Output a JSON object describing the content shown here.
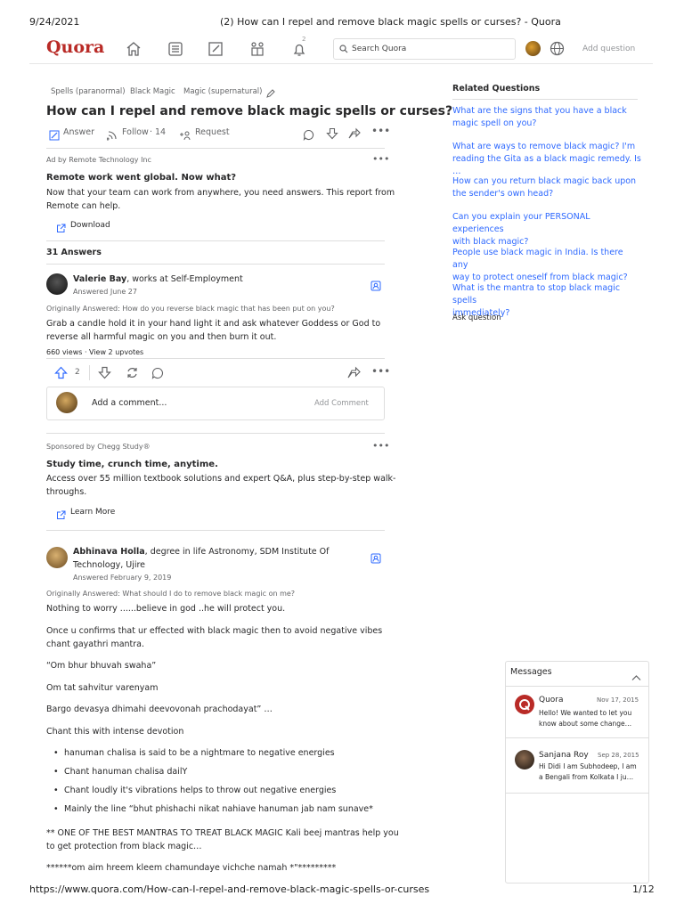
{
  "print_header": {
    "date": "9/24/2021",
    "title": "(2) How can I repel and remove black magic spells or curses? - Quora"
  },
  "print_footer": {
    "url": "https://www.quora.com/How-can-I-repel-and-remove-black-magic-spells-or-curses",
    "page": "1/12"
  },
  "nav": {
    "logo": "Quora",
    "notif_count": "2",
    "search_placeholder": "Search Quora",
    "add_question": "Add question",
    "icons": [
      "home-icon",
      "following-icon",
      "answer-icon",
      "spaces-icon",
      "notifications-icon",
      "globe-icon"
    ]
  },
  "question": {
    "topics": [
      "Spells (paranormal)",
      "Black Magic",
      "Magic (supernatural)"
    ],
    "title": "How can I repel and remove black magic spells or curses?",
    "actions": {
      "answer": "Answer",
      "follow": "Follow",
      "follow_count": "14",
      "request": "Request"
    }
  },
  "ad1": {
    "label": "Ad by Remote Technology Inc",
    "headline": "Remote work went global. Now what?",
    "line1": "Now that your team can work from anywhere, you need answers. This report from",
    "line2": "Remote can help.",
    "cta": "Download"
  },
  "answers_count": "31 Answers",
  "answer1": {
    "name": "Valerie Bay",
    "cred": ", works at Self-Employment",
    "date": "Answered June 27",
    "orig": "Originally Answered: How do you reverse black magic that has been put on you?",
    "line1": "Grab a candle hold it in your hand light it and ask whatever Goddess or God to",
    "line2": "reverse all harmful magic on you and then burn it out.",
    "stats": "660 views · View 2 upvotes",
    "upvotes": "2",
    "comment_placeholder": "Add a comment...",
    "comment_btn": "Add Comment"
  },
  "ad2": {
    "label": "Sponsored by Chegg Study®",
    "headline": "Study time, crunch time, anytime.",
    "line1": "Access over 55 million textbook solutions and expert Q&A, plus step-by-step walk-",
    "line2": "throughs.",
    "cta": "Learn More"
  },
  "answer2": {
    "name": "Abhinava Holla",
    "cred1": ", degree in life Astronomy, SDM Institute Of",
    "cred2": "Technology, Ujire",
    "date": "Answered February 9, 2019",
    "orig": "Originally Answered: What should I do to remove black magic on me?",
    "p1": "Nothing to worry ......believe in god ..he will protect you.",
    "p2a": "Once u confirms that ur effected with black magic then to avoid negative vibes",
    "p2b": "chant gayathri mantra.",
    "p3": "“Om bhur bhuvah swaha”",
    "p4": "Om tat sahvitur varenyam",
    "p5": "Bargo devasya dhimahi deevovonah prachodayat” …",
    "p6": "Chant this with intense devotion",
    "bullets": [
      "hanuman chalisa is said to be a nightmare to negative energies",
      "Chant hanuman chalisa dailY",
      "Chant loudly it's vibrations helps to throw out negative energies",
      "Mainly the line “bhut phishachi nikat nahiave hanuman jab nam sunave*"
    ],
    "p7a": "** ONE OF THE BEST MANTRAS TO TREAT BLACK MAGIC Kali beej mantras help you",
    "p7b": "to get protection from black magic…",
    "p8": "******om aim hreem kleem chamundaye vichche namah *\"*********"
  },
  "related": {
    "title": "Related Questions",
    "items": [
      [
        "What are the signs that you have a black",
        "magic spell on you?"
      ],
      [
        "What are ways to remove black magic? I'm",
        "reading the Gita as a black magic remedy. Is …"
      ],
      [
        "How can you return black magic back upon",
        "the sender's own head?"
      ],
      [
        "Can you explain your PERSONAL experiences",
        "with black magic?"
      ],
      [
        "People use black magic in India. Is there any",
        "way to protect oneself from black magic?"
      ],
      [
        "What is the mantra to stop black magic spells",
        "immediately?"
      ]
    ],
    "ask": "Ask question"
  },
  "messages": {
    "title": "Messages",
    "items": [
      {
        "name": "Quora",
        "date": "Nov 17, 2015",
        "line1": "Hello! We wanted to let you",
        "line2": "know about some change…"
      },
      {
        "name": "Sanjana Roy",
        "date": "Sep 28, 2015",
        "line1": "Hi Didi I am Subhodeep, I am",
        "line2": "a Bengali from Kolkata I ju…"
      }
    ]
  },
  "colors": {
    "brand": "#b92b27",
    "link": "#2e69ff",
    "upvote": "#2e69ff"
  }
}
